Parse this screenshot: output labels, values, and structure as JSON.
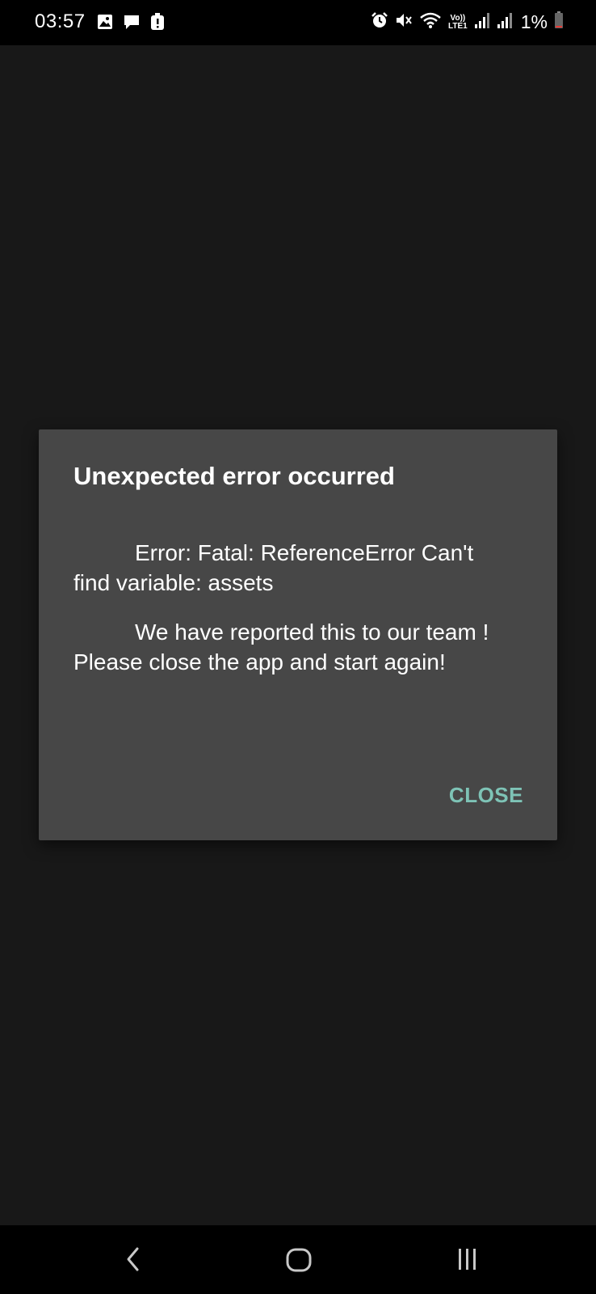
{
  "status_bar": {
    "time": "03:57",
    "network_label_top": "Vo))",
    "network_label_bottom": "LTE1",
    "battery_percent": "1%",
    "left_icons": [
      "image-icon",
      "message-icon",
      "alert-icon"
    ],
    "right_icons": [
      "alarm-icon",
      "mute-icon",
      "wifi-icon",
      "signal-icon",
      "signal-icon",
      "battery-icon"
    ]
  },
  "dialog": {
    "title": "Unexpected error occurred",
    "paragraphs": [
      "Error: Fatal: ReferenceError Can't find variable: assets",
      "We have reported this to our team ! Please close the app and start again!"
    ],
    "close_label": "CLOSE"
  },
  "nav_bar": {
    "icons": [
      "back-icon",
      "home-icon",
      "recent-apps-icon"
    ]
  },
  "colors": {
    "background": "#181818",
    "dialog_background": "#474747",
    "accent": "#7ec3b6",
    "bars": "#000000"
  }
}
